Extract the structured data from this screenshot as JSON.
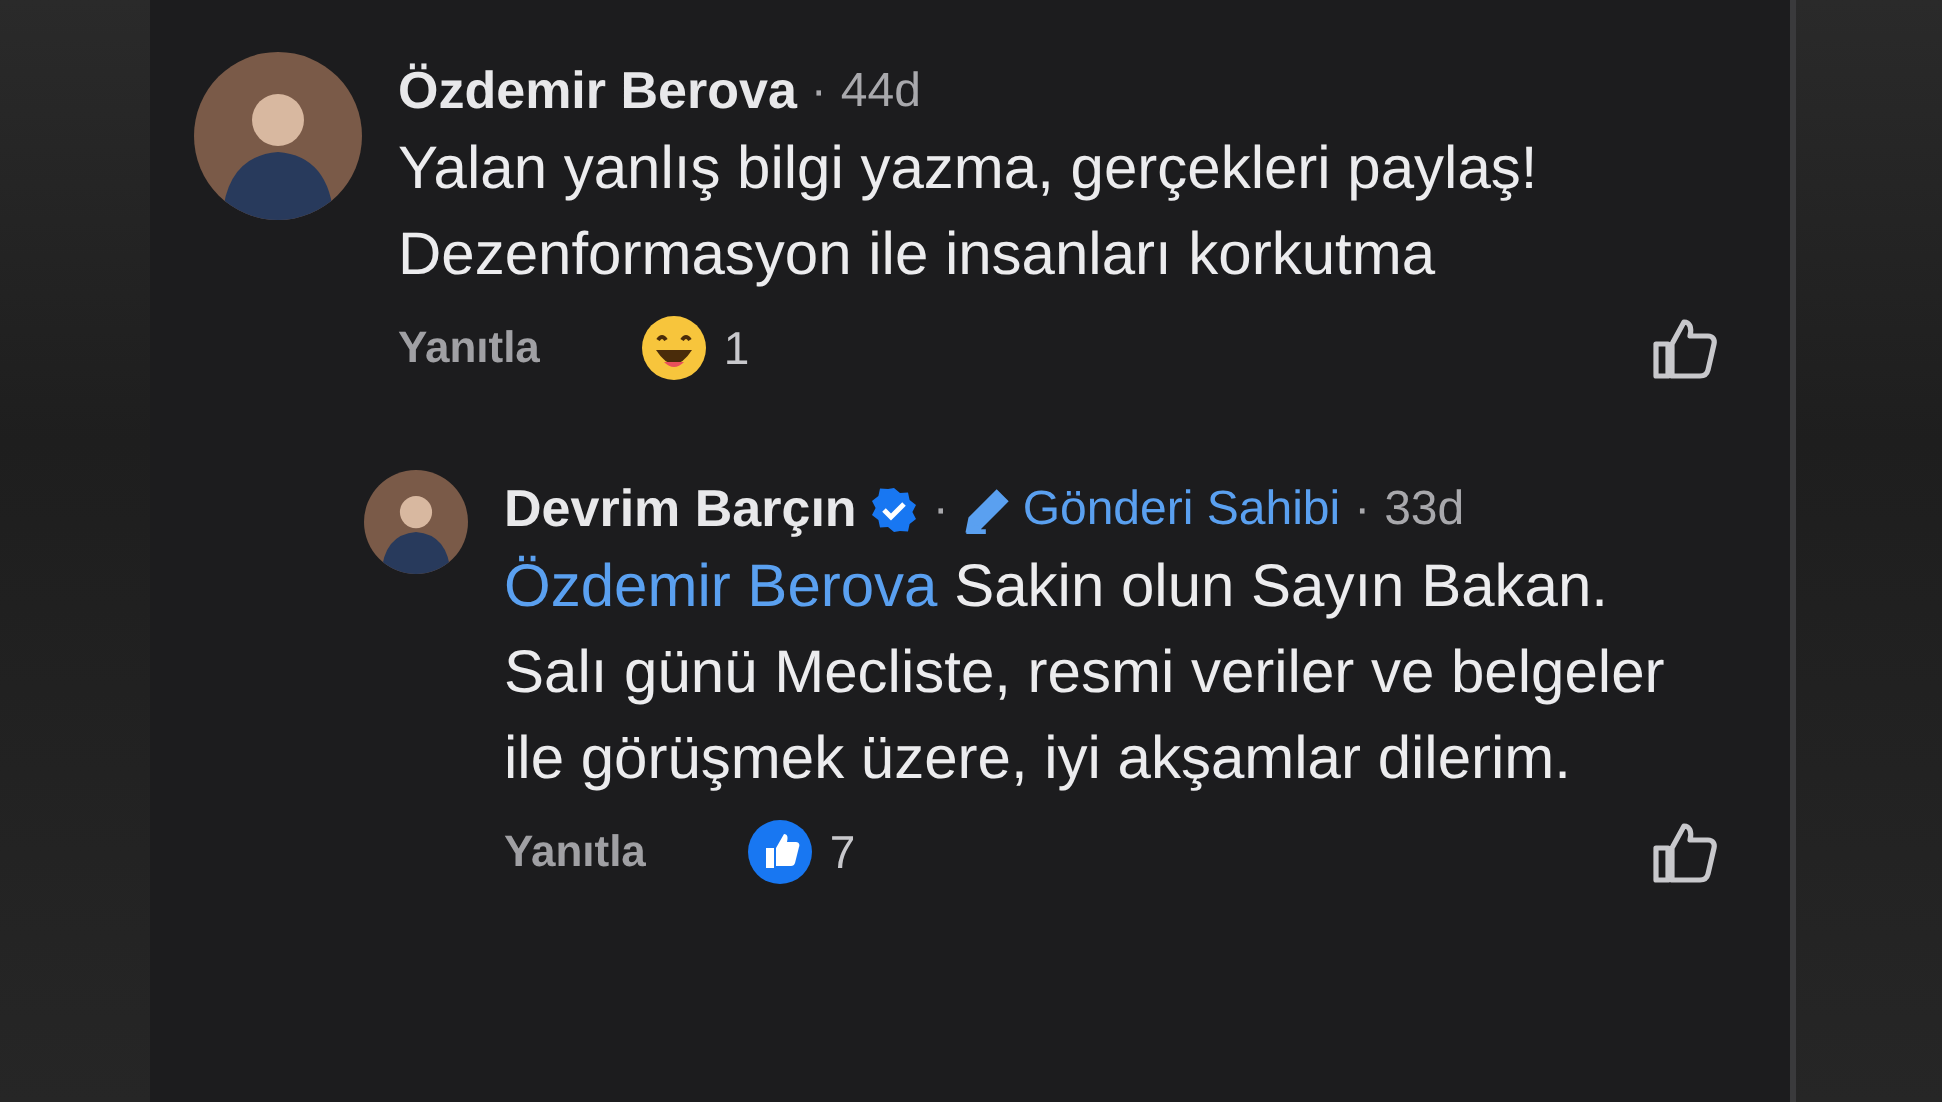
{
  "comments": [
    {
      "author": "Özdemir Berova",
      "verified": false,
      "dots": [
        "·"
      ],
      "time": "44d",
      "text": "Yalan yanlış bilgi yazma, gerçekleri paylaş! Dezenformasyon ile insanları korkutma",
      "reply_label": "Yanıtla",
      "reaction": {
        "kind": "haha",
        "count": "1"
      },
      "reply": false
    },
    {
      "author": "Devrim Barçın",
      "verified": true,
      "dots": [
        "·",
        "·"
      ],
      "owner_badge": "Gönderi Sahibi",
      "time": "33d",
      "mention": "Özdemir Berova",
      "text": "Sakin olun Sayın Bakan. Salı günü Mecliste, resmi veriler ve belgeler ile görüşmek üzere, iyi akşamlar dilerim.",
      "reply_label": "Yanıtla",
      "reaction": {
        "kind": "like",
        "count": "7"
      },
      "reply": true
    }
  ]
}
